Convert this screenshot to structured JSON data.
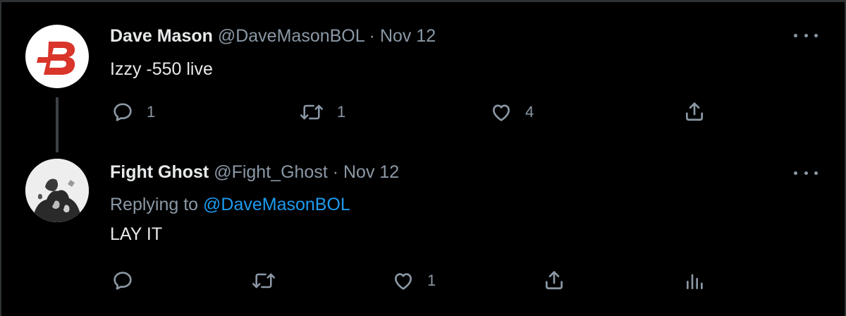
{
  "tweets": [
    {
      "display_name": "Dave Mason",
      "handle": "@DaveMasonBOL",
      "separator": "·",
      "date": "Nov 12",
      "text": "Izzy -550 live",
      "avatar_letter": "B",
      "avatar_color": "#d9352b",
      "more_icon": "ellipsis-icon",
      "actions": {
        "reply_count": "1",
        "retweet_count": "1",
        "like_count": "4"
      }
    },
    {
      "display_name": "Fight Ghost",
      "handle": "@Fight_Ghost",
      "separator": "·",
      "date": "Nov 12",
      "replying_label": "Replying to",
      "replying_to": "@DaveMasonBOL",
      "text": "LAY IT",
      "more_icon": "ellipsis-icon",
      "actions": {
        "reply_count": "",
        "retweet_count": "",
        "like_count": "1"
      }
    }
  ],
  "colors": {
    "background": "#000000",
    "primary_text": "#e7e9ea",
    "secondary_text": "#8b98a5",
    "link": "#1d9bf0"
  }
}
